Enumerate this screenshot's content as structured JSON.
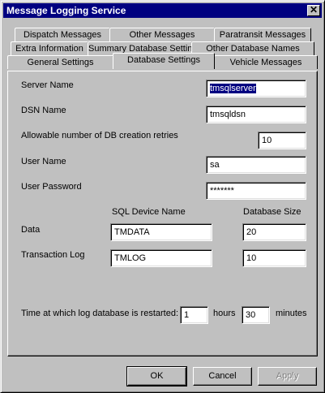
{
  "window": {
    "title": "Message Logging Service",
    "close_glyph": "✕"
  },
  "tabs": {
    "row1": [
      "Dispatch Messages",
      "Other Messages",
      "Paratransit Messages"
    ],
    "row2": [
      "Extra Information",
      "Summary Database Settings",
      "Other Database Names"
    ],
    "row3": [
      "General Settings",
      "Database Settings",
      "Vehicle Messages"
    ],
    "active": "Database Settings"
  },
  "form": {
    "server_name": {
      "label": "Server Name",
      "value": "tmsqlserver"
    },
    "dsn_name": {
      "label": "DSN Name",
      "value": "tmsqldsn"
    },
    "retries": {
      "label": "Allowable number of DB creation retries",
      "value": "10"
    },
    "user_name": {
      "label": "User Name",
      "value": "sa"
    },
    "user_password": {
      "label": "User Password",
      "value": "*******"
    },
    "headers": {
      "device": "SQL Device Name",
      "size": "Database Size"
    },
    "data": {
      "label": "Data",
      "device": "TMDATA",
      "size": "20"
    },
    "transaction_log": {
      "label": "Transaction Log",
      "device": "TMLOG",
      "size": "10"
    },
    "restart": {
      "label": "Time at which log database is restarted:",
      "hours": "1",
      "hours_label": "hours",
      "minutes": "30",
      "minutes_label": "minutes"
    }
  },
  "buttons": {
    "ok": "OK",
    "cancel": "Cancel",
    "apply": "Apply"
  }
}
